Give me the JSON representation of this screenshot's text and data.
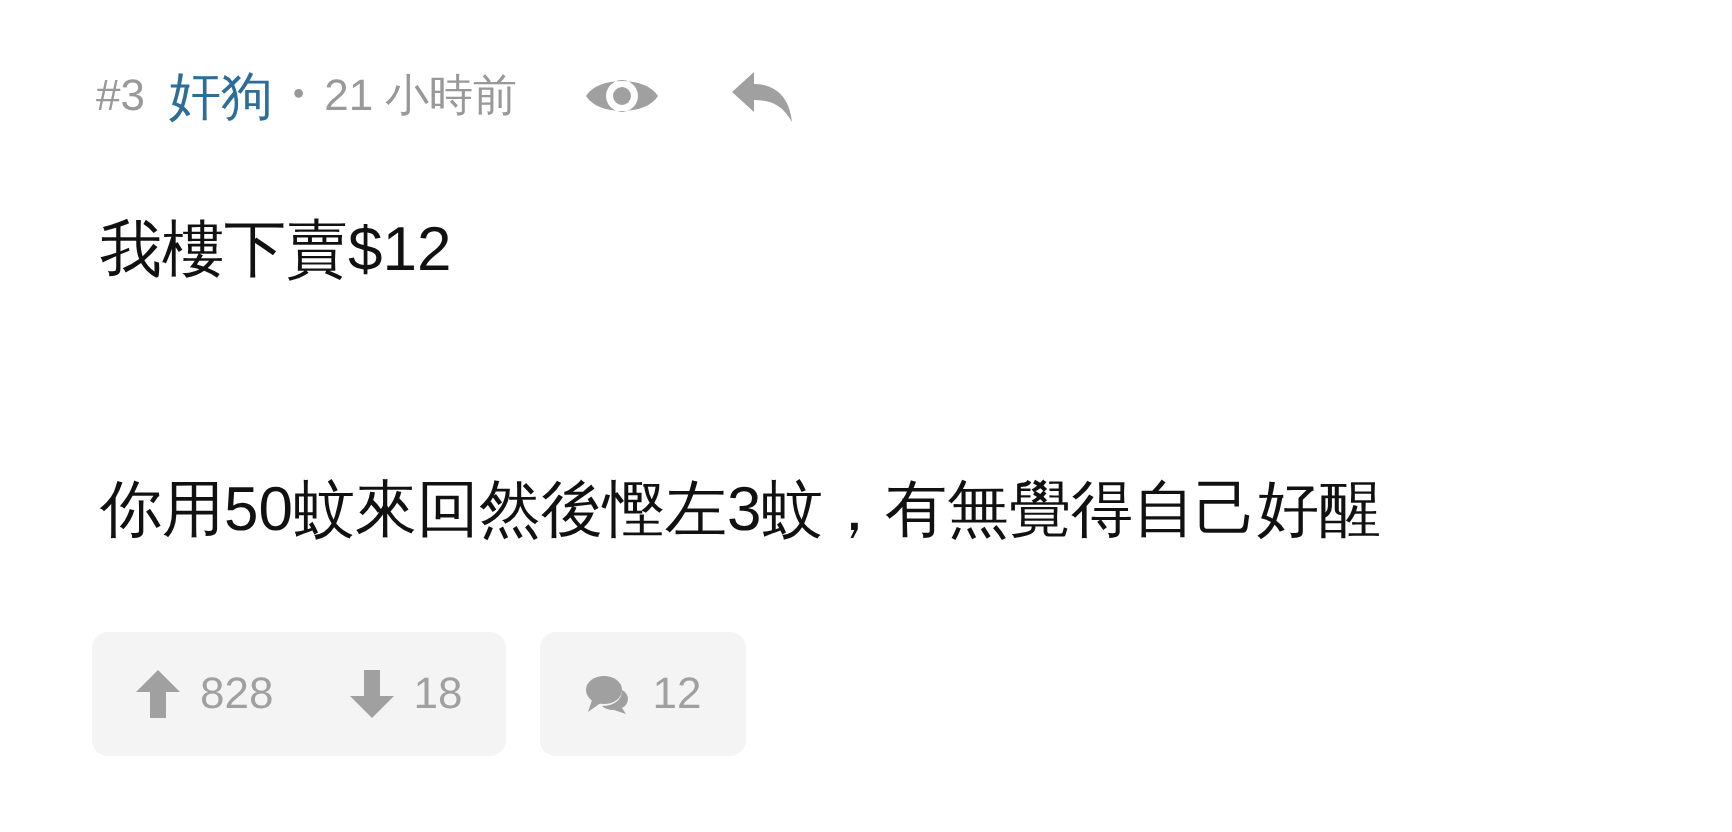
{
  "post": {
    "number": "#3",
    "author": "奸狗",
    "separator": "•",
    "time": "21 小時前"
  },
  "paragraphs": [
    "我樓下賣$12",
    "你用50蚊來回然後慳左3蚊，有無覺得自己好醒"
  ],
  "footer": {
    "upvotes": "828",
    "downvotes": "18",
    "replies": "12"
  }
}
